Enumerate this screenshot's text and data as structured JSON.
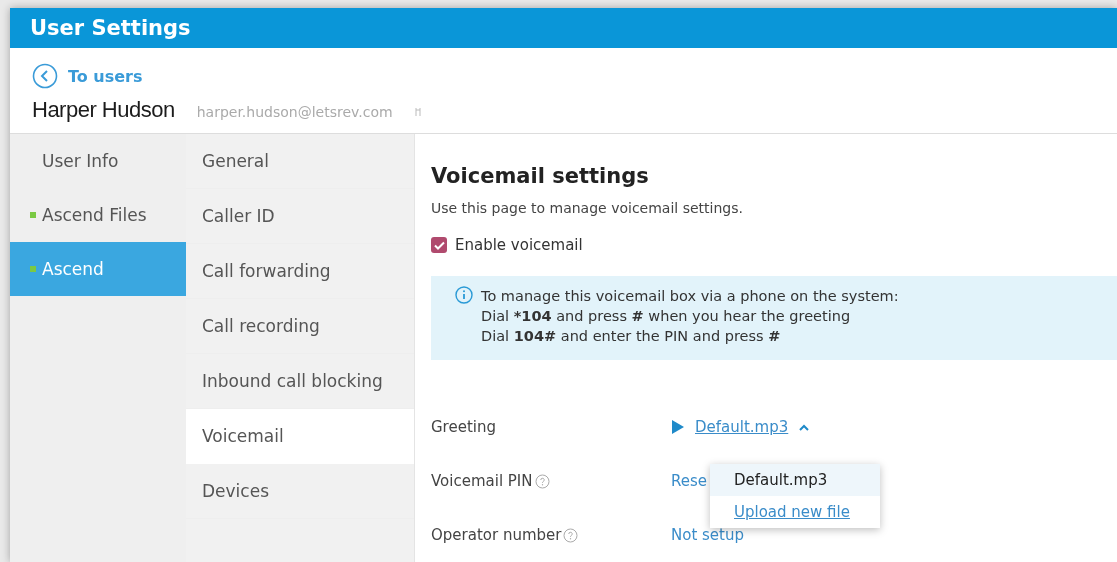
{
  "window": {
    "title": "User Settings"
  },
  "back_link": {
    "label": "To users"
  },
  "user": {
    "name": "Harper Hudson",
    "email": "harper.hudson@letsrev.com"
  },
  "sidebar": {
    "items": [
      {
        "label": "User Info",
        "selected": false
      },
      {
        "label": "Ascend Files",
        "selected": false,
        "color": "#7ac943"
      },
      {
        "label": "Ascend",
        "selected": true,
        "color": "#7ac943"
      }
    ]
  },
  "subnav": {
    "items": [
      {
        "label": "General",
        "selected": false
      },
      {
        "label": "Caller ID",
        "selected": false
      },
      {
        "label": "Call forwarding",
        "selected": false
      },
      {
        "label": "Call recording",
        "selected": false
      },
      {
        "label": "Inbound call blocking",
        "selected": false
      },
      {
        "label": "Voicemail",
        "selected": true
      },
      {
        "label": "Devices",
        "selected": false
      }
    ]
  },
  "content": {
    "title": "Voicemail settings",
    "description": "Use this page to manage voicemail settings.",
    "enable": {
      "label": "Enable voicemail",
      "checked": true
    },
    "info": [
      "To manage this voicemail box via a phone on the system:",
      "Dial ***104** and press **#** when you hear the greeting",
      "Dial **104#** and enter the PIN and press **#**"
    ],
    "settings": [
      {
        "label": "Greeting",
        "help": false,
        "kind": "file",
        "value": "Default.mp3",
        "expanded": true
      },
      {
        "label": "Voicemail PIN",
        "help": true,
        "kind": "link",
        "value": "Rese"
      },
      {
        "label": "Operator number",
        "help": true,
        "kind": "link",
        "value": "Not setup"
      }
    ],
    "dropdown": {
      "items": [
        {
          "label": "Default.mp3",
          "kind": "option",
          "selected": true
        },
        {
          "label": "Upload new file",
          "kind": "link",
          "selected": false
        }
      ]
    }
  }
}
